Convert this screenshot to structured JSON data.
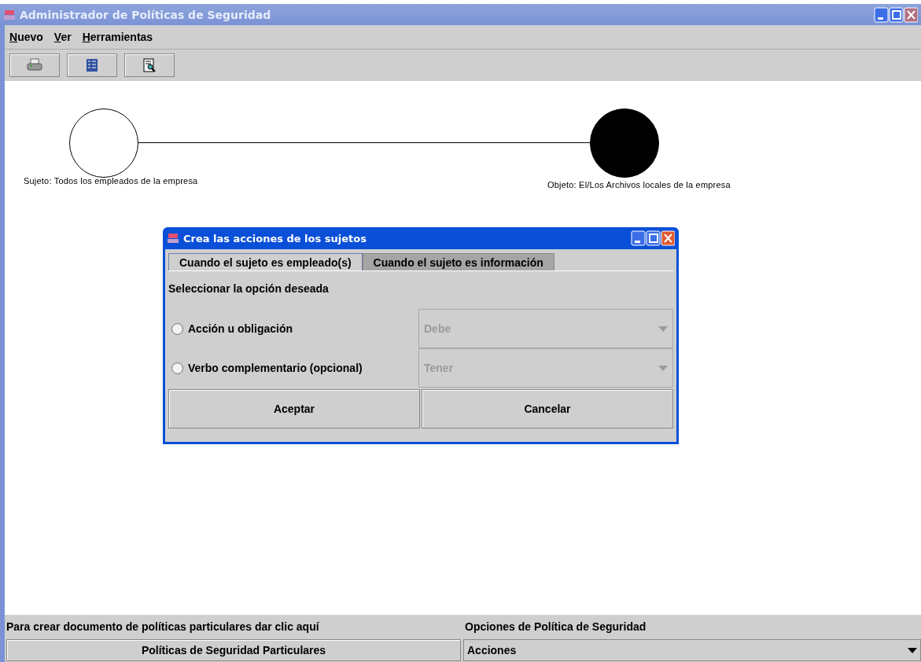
{
  "window": {
    "title": "Administrador de Políticas de Seguridad"
  },
  "menu": [
    "Nuevo",
    "Ver",
    "Herramientas"
  ],
  "toolbar": [
    {
      "kind": "print"
    },
    {
      "kind": "list"
    },
    {
      "kind": "preview"
    }
  ],
  "diagram": {
    "subject": {
      "label": "Sujeto: Todos los empleados de la empresa",
      "filled": false
    },
    "object": {
      "label": "Objeto: El/Los Archivos locales de la empresa",
      "filled": true
    }
  },
  "dialog": {
    "title": "Crea las acciones de los sujetos",
    "tabs": [
      {
        "label": "Cuando el sujeto es empleado(s)",
        "selected": true
      },
      {
        "label": "Cuando el sujeto es información",
        "selected": false
      }
    ],
    "prompt": "Seleccionar la opción deseada",
    "options": [
      {
        "label": "Acción u obligación",
        "selected": false,
        "value": "Debe",
        "disabled": true
      },
      {
        "label": "Verbo complementario (opcional)",
        "selected": false,
        "value": "Tener",
        "disabled": true
      }
    ],
    "buttons": [
      "Aceptar",
      "Cancelar"
    ]
  },
  "bottom": {
    "left_label": "Para crear documento de políticas particulares dar clic aquí",
    "left_button": "Políticas de Seguridad Particulares",
    "right_label": "Opciones de Política de Seguridad",
    "right_value": "Acciones"
  }
}
